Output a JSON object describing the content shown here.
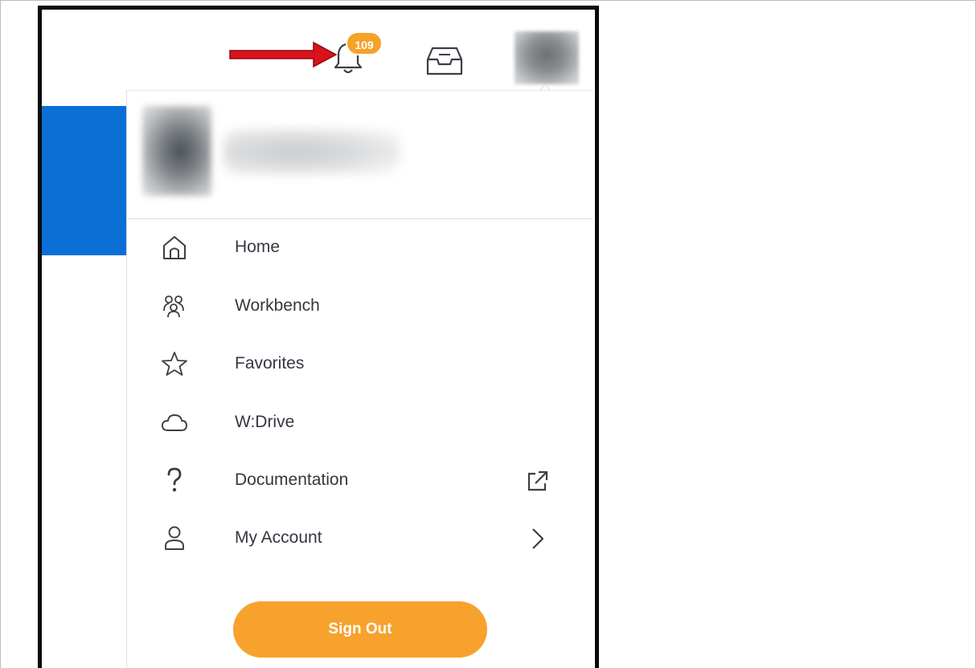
{
  "notifications": {
    "badge_count": "109",
    "badge_color": "#f5a229"
  },
  "header": {
    "banner_color": "#0b6fd6"
  },
  "menu": {
    "items": [
      {
        "label": "Home",
        "icon": "home-icon"
      },
      {
        "label": "Workbench",
        "icon": "workbench-icon"
      },
      {
        "label": "Favorites",
        "icon": "star-icon"
      },
      {
        "label": "W:Drive",
        "icon": "cloud-icon"
      },
      {
        "label": "Documentation",
        "icon": "question-icon",
        "trailing_icon": "external-link-icon"
      },
      {
        "label": "My Account",
        "icon": "person-icon",
        "trailing_icon": "chevron-right-icon"
      }
    ]
  },
  "sign_out": {
    "label": "Sign Out",
    "color": "#f7a22d"
  },
  "annotations": {
    "arrow_color_top": "#d8131a",
    "arrow_color_side": "#d9403f"
  }
}
